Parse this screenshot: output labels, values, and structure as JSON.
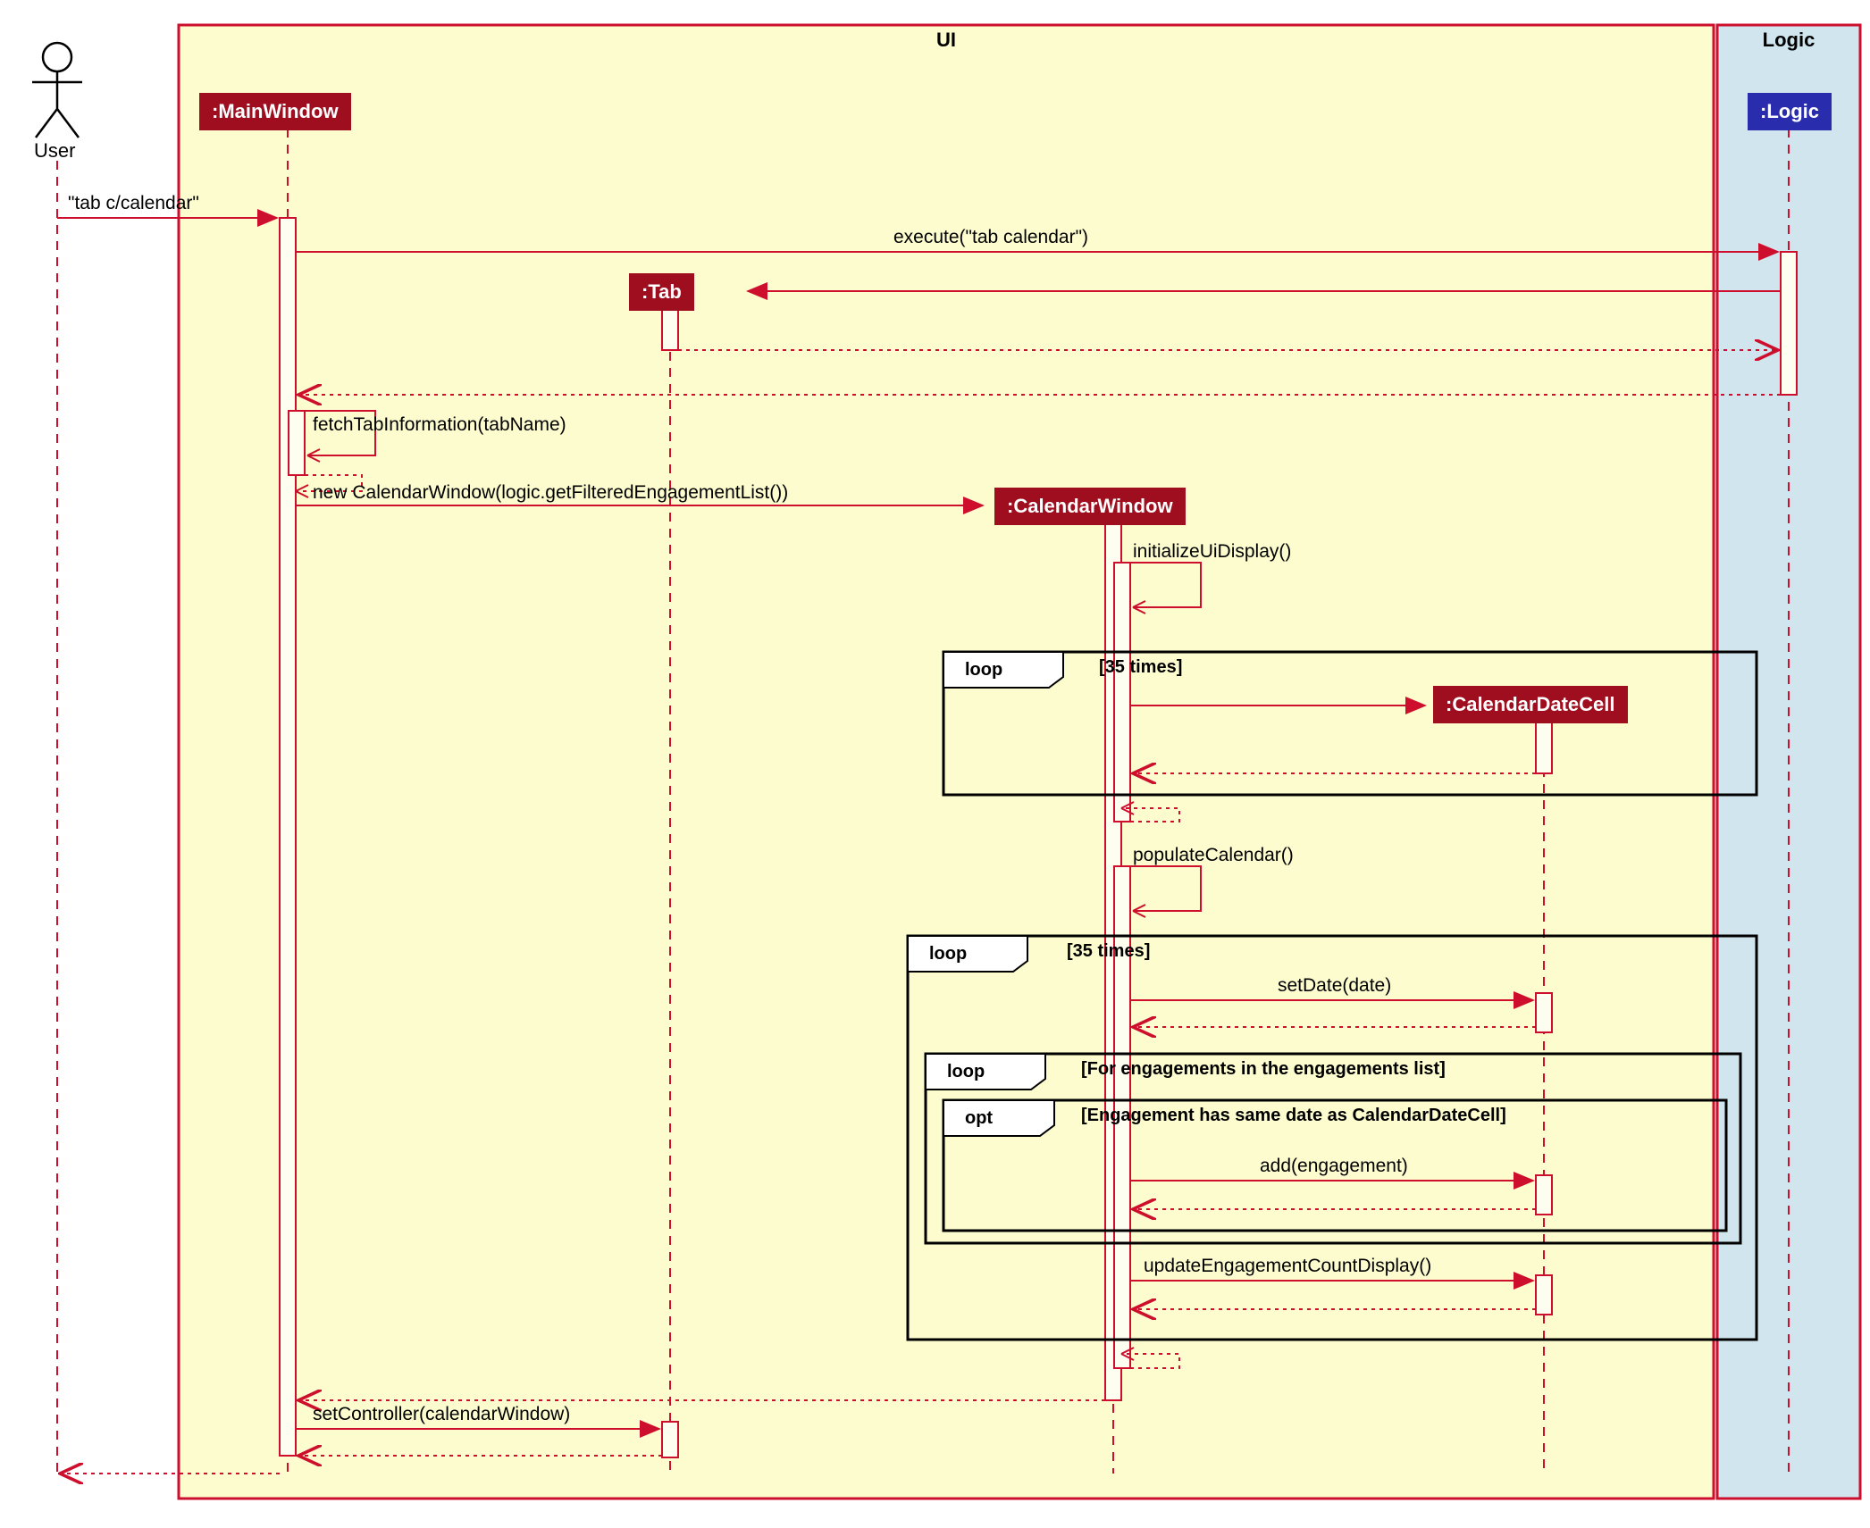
{
  "actor": {
    "name": "User"
  },
  "boxes": {
    "ui": {
      "label": "UI",
      "fill": "#FDFCCE",
      "stroke": "#CD0E2D"
    },
    "logic": {
      "label": "Logic",
      "fill": "#D0E5EE",
      "stroke": "#CD0E2D"
    }
  },
  "lifelines": {
    "mainwindow": {
      "label": ":MainWindow",
      "fill": "#9E0E1E",
      "textColor": "#ffffff"
    },
    "tab": {
      "label": ":Tab",
      "fill": "#9E0E1E",
      "textColor": "#ffffff"
    },
    "calendarwindow": {
      "label": ":CalendarWindow",
      "fill": "#9E0E1E",
      "textColor": "#ffffff"
    },
    "calendardatecell": {
      "label": ":CalendarDateCell",
      "fill": "#9E0E1E",
      "textColor": "#ffffff"
    },
    "logic": {
      "label": ":Logic",
      "fill": "#2A2CAE",
      "textColor": "#ffffff"
    }
  },
  "messages": {
    "m1": "\"tab c/calendar\"",
    "m2": "execute(\"tab calendar\")",
    "m3": "fetchTabInformation(tabName)",
    "m4": "new CalendarWindow(logic.getFilteredEngagementList())",
    "m5": "initializeUiDisplay()",
    "m6": "populateCalendar()",
    "m7": "setDate(date)",
    "m8": "add(engagement)",
    "m9": "updateEngagementCountDisplay()",
    "m10": "setController(calendarWindow)"
  },
  "fragments": {
    "loop1": {
      "type": "loop",
      "guard": "[35 times]"
    },
    "loop2": {
      "type": "loop",
      "guard": "[35 times]"
    },
    "loop3": {
      "type": "loop",
      "guard": "[For engagements in the engagements list]"
    },
    "opt1": {
      "type": "opt",
      "guard": "[Engagement has same date as CalendarDateCell]"
    }
  },
  "colors": {
    "darkred": "#9E0E1E",
    "red": "#CD0E2D",
    "blue": "#2A2CAE",
    "yellow": "#FDFCCE",
    "lightblue": "#D0E5EE",
    "activation": "#FEFEF0"
  }
}
